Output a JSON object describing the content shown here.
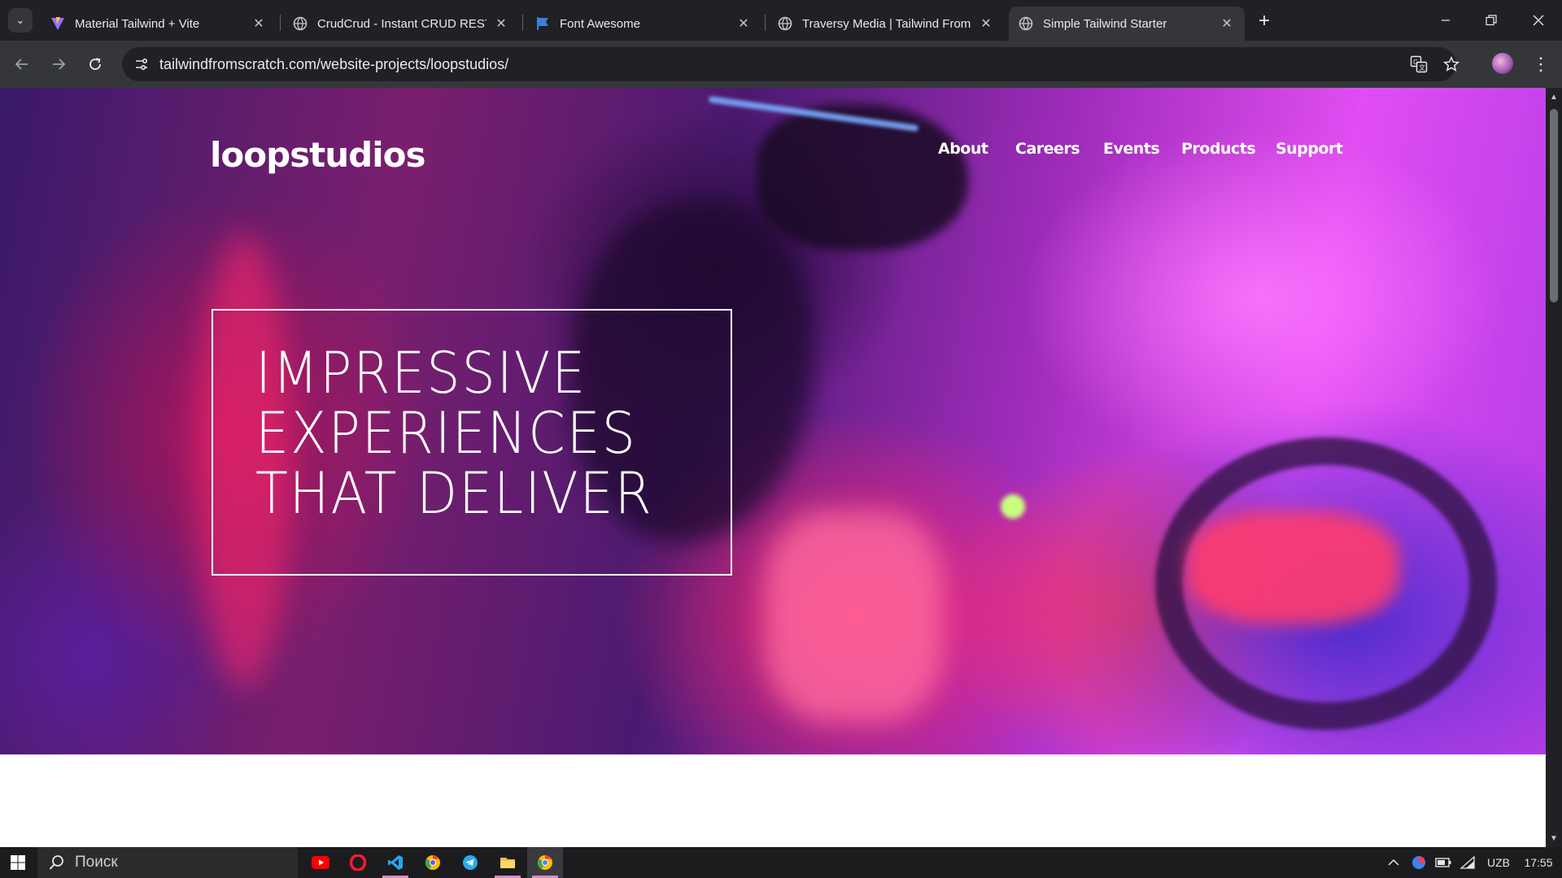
{
  "browser": {
    "tabs": [
      {
        "title": "Material Tailwind + Vite",
        "icon": "vite-icon",
        "active": false
      },
      {
        "title": "CrudCrud - Instant CRUD REST",
        "icon": "globe-icon",
        "active": false
      },
      {
        "title": "Font Awesome",
        "icon": "flag-icon",
        "active": false
      },
      {
        "title": "Traversy Media | Tailwind From",
        "icon": "globe-icon",
        "active": false
      },
      {
        "title": "Simple Tailwind Starter",
        "icon": "globe-icon",
        "active": true
      }
    ],
    "url": "tailwindfromscratch.com/website-projects/loopstudios/"
  },
  "site": {
    "brand": "loopstudios",
    "nav": [
      "About",
      "Careers",
      "Events",
      "Products",
      "Support"
    ],
    "hero_lines": [
      "IMPRESSIVE",
      "EXPERIENCES",
      "THAT DELIVER"
    ]
  },
  "taskbar": {
    "search_placeholder": "Поиск",
    "language": "UZB",
    "time": "17:55"
  },
  "colors": {
    "hero_pink": "#e04df2",
    "hero_red": "#ff2870",
    "hero_purple": "#3a1a6a",
    "browser_dark": "#202124"
  }
}
